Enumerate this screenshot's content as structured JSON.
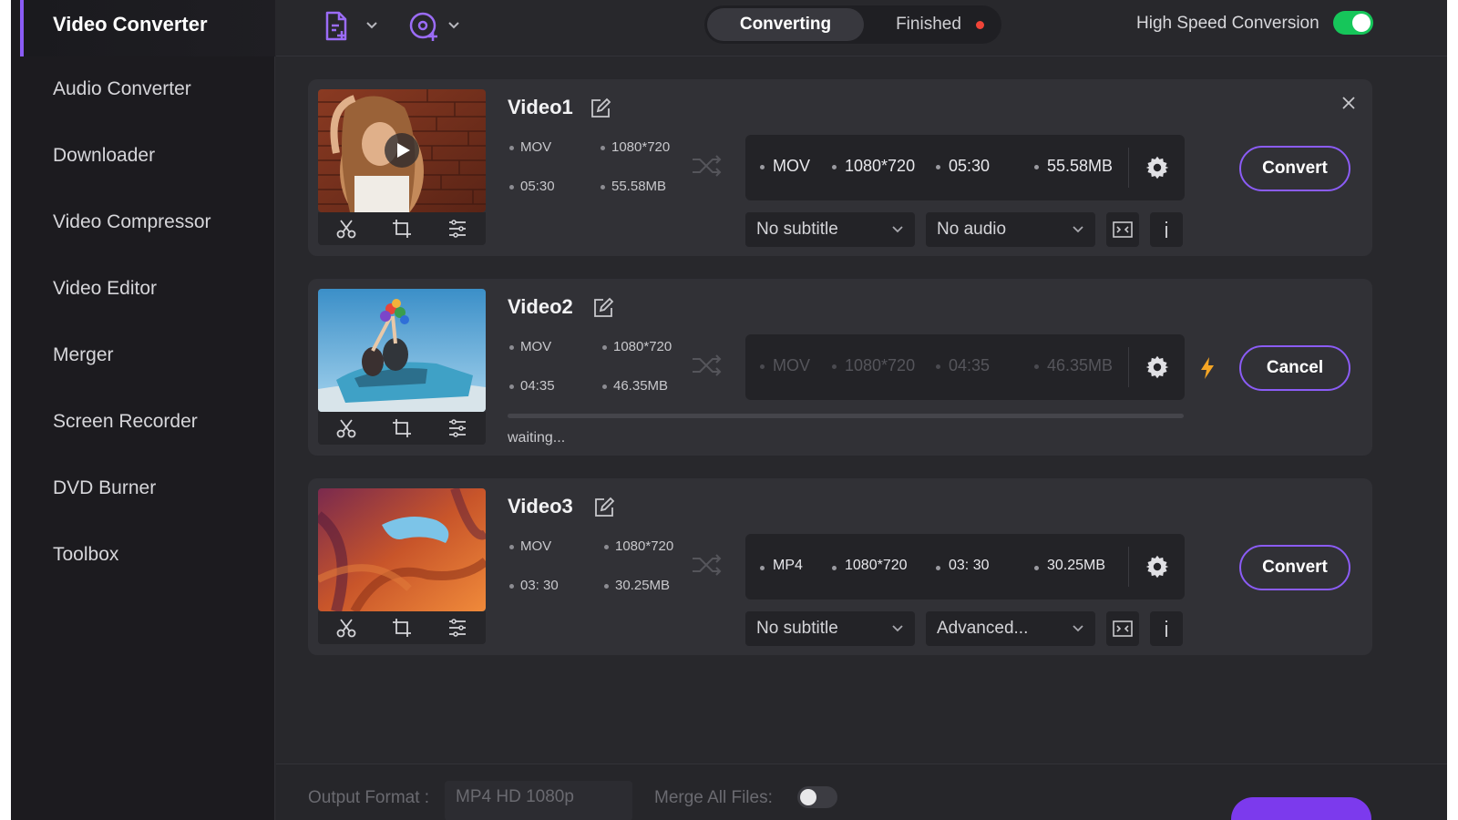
{
  "sidebar": {
    "active": "Video Converter",
    "items": [
      "Audio Converter",
      "Downloader",
      "Video Compressor",
      "Video Editor",
      "Merger",
      "Screen Recorder",
      "DVD Burner",
      "Toolbox"
    ]
  },
  "topbar": {
    "tab_converting": "Converting",
    "tab_finished": "Finished",
    "high_speed_label": "High Speed Conversion",
    "high_speed_on": true
  },
  "videos": [
    {
      "name": "Video1",
      "src": {
        "format": "MOV",
        "resolution": "1080*720",
        "duration": "05:30",
        "size": "55.58MB"
      },
      "target": {
        "format": "MOV",
        "resolution": "1080*720",
        "duration": "05:30",
        "size": "55.58MB"
      },
      "subtitle": "No subtitle",
      "audio": "No audio",
      "action": "Convert"
    },
    {
      "name": "Video2",
      "src": {
        "format": "MOV",
        "resolution": "1080*720",
        "duration": "04:35",
        "size": "46.35MB"
      },
      "target": {
        "format": "MOV",
        "resolution": "1080*720",
        "duration": "04:35",
        "size": "46.35MB"
      },
      "status": "waiting...",
      "action": "Cancel"
    },
    {
      "name": "Video3",
      "src": {
        "format": "MOV",
        "resolution": "1080*720",
        "duration": "03: 30",
        "size": "30.25MB"
      },
      "target": {
        "format": "MP4",
        "resolution": "1080*720",
        "duration": "03: 30",
        "size": "30.25MB"
      },
      "subtitle": "No subtitle",
      "audio": "Advanced...",
      "action": "Convert"
    }
  ],
  "bottombar": {
    "output_format_label": "Output Format :",
    "output_format_value": "MP4 HD 1080p",
    "merge_label": "Merge All Files:",
    "merge_on": false
  },
  "colors": {
    "accent": "#8b5cf6",
    "toggle_on": "#16c65a",
    "dot_red": "#f04438",
    "bolt": "#f5a524"
  }
}
